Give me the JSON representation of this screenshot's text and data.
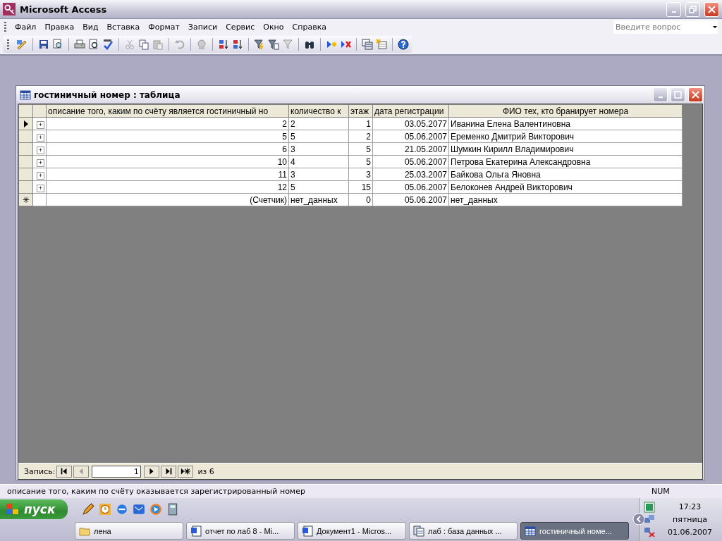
{
  "window": {
    "title": "Microsoft Access"
  },
  "menu": [
    {
      "label": "Файл"
    },
    {
      "label": "Правка"
    },
    {
      "label": "Вид"
    },
    {
      "label": "Вставка"
    },
    {
      "label": "Формат"
    },
    {
      "label": "Записи"
    },
    {
      "label": "Сервис"
    },
    {
      "label": "Окно"
    },
    {
      "label": "Справка"
    }
  ],
  "help_box": {
    "placeholder": "Введите вопрос"
  },
  "datasheet": {
    "title": "гостиничный номер : таблица",
    "columns": [
      "описание того, каким по счёту является гостиничный но",
      "количество к",
      "этаж",
      "дата регистрации",
      "ФИО тех, кто бранирует номера"
    ],
    "rows": [
      {
        "kind": "record",
        "current": true,
        "expand": "+",
        "cells": [
          "2",
          "2",
          "1",
          "03.05.2077",
          "Иванина Елена Валентиновна"
        ]
      },
      {
        "kind": "record",
        "current": false,
        "expand": "+",
        "cells": [
          "5",
          "5",
          "2",
          "05.06.2007",
          "Еременко Дмитрий Викторович"
        ]
      },
      {
        "kind": "record",
        "current": false,
        "expand": "+",
        "cells": [
          "6",
          "3",
          "5",
          "21.05.2007",
          "Шумкин Кирилл Владимирович"
        ]
      },
      {
        "kind": "record",
        "current": false,
        "expand": "+",
        "cells": [
          "10",
          "4",
          "5",
          "05.06.2007",
          "Петрова Екатерина Александровна"
        ]
      },
      {
        "kind": "record",
        "current": false,
        "expand": "+",
        "cells": [
          "11",
          "3",
          "3",
          "25.03.2007",
          "Байкова Ольга Яновна"
        ]
      },
      {
        "kind": "record",
        "current": false,
        "expand": "+",
        "cells": [
          "12",
          "5",
          "15",
          "05.06.2007",
          "Белоконев Андрей Викторович"
        ]
      },
      {
        "kind": "new",
        "marker": "✳",
        "cells": [
          "(Счетчик)",
          "нет_данных",
          "0",
          "05.06.2007",
          "нет_данных"
        ]
      }
    ],
    "navigator": {
      "label": "Запись:",
      "value": "1",
      "total": "из 6",
      "buttons": [
        {
          "kind": "first",
          "disabled": false
        },
        {
          "kind": "prev",
          "disabled": true
        }
      ],
      "buttons_after": [
        {
          "kind": "next",
          "disabled": false
        },
        {
          "kind": "last",
          "disabled": false
        },
        {
          "kind": "new",
          "disabled": false
        }
      ]
    }
  },
  "status_bar": {
    "text": "описание того, каким по счёту оказывается зарегистрированный номер",
    "indicator": "NUM"
  },
  "taskbar": {
    "start": "пуск",
    "tasks": [
      {
        "label": "лена",
        "kind": "folder",
        "selected": false
      },
      {
        "label": "отчет по лаб 8 - Mi...",
        "kind": "word",
        "selected": false
      },
      {
        "label": "Документ1 - Micros...",
        "kind": "word",
        "selected": false
      },
      {
        "label": "лаб : база данных ...",
        "kind": "access",
        "selected": false
      },
      {
        "label": "гостиничный номе...",
        "kind": "table",
        "selected": true
      }
    ],
    "clock": {
      "time": "17:23",
      "day": "пятница",
      "date": "01.06.2007"
    }
  }
}
